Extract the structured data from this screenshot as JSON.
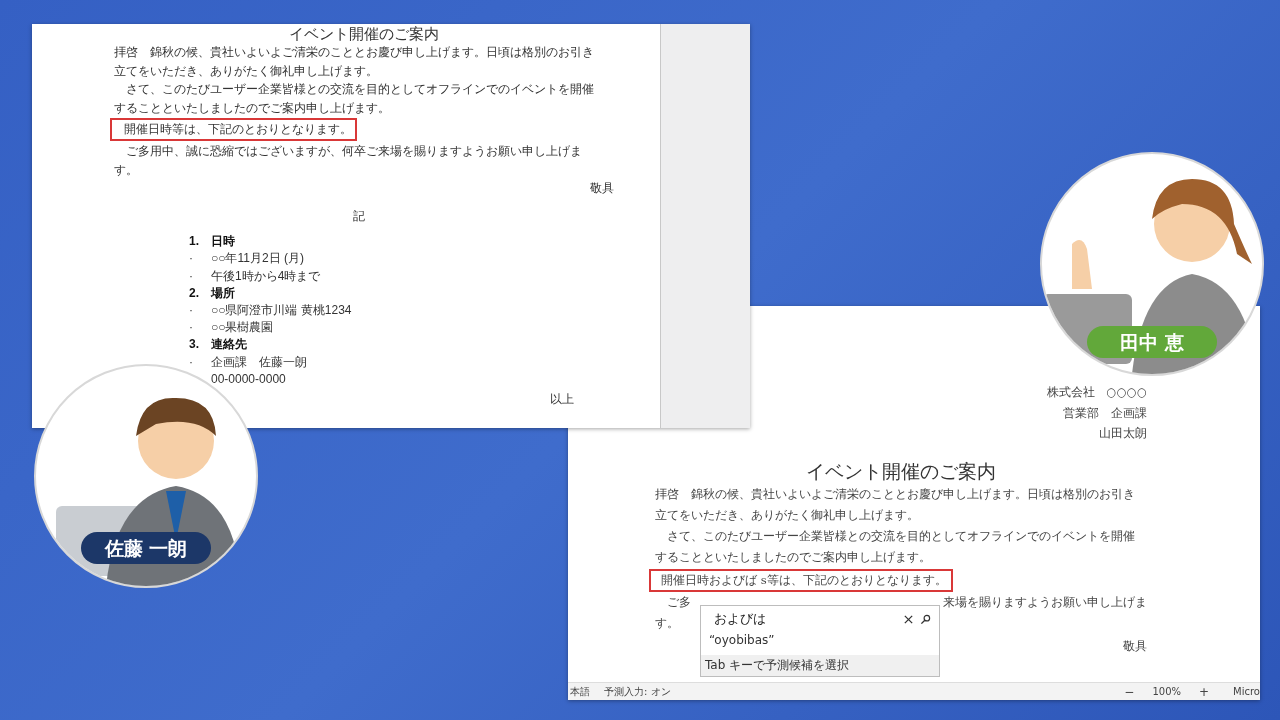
{
  "shared_document": {
    "title": "イベント開催のご案内",
    "lines": [
      {
        "text": "拝啓　錦秋の候、貴社いよいよご清栄のこととお慶び申し上げます。日頃は格別のお引き",
        "highlighted": false
      },
      {
        "text": "立てをいただき、ありがたく御礼申し上げます。",
        "highlighted": false
      },
      {
        "text": "　さて、このたびユーザー企業皆様との交流を目的としてオフラインでのイベントを開催",
        "highlighted": false
      },
      {
        "text": "することといたしましたのでご案内申し上げます。",
        "highlighted": false
      },
      {
        "text": "開催日時等は、下記のとおりとなります。",
        "highlighted": true
      },
      {
        "text": "　ご多用中、誠に恐縮ではございますが、何卒ご来場を賜りますようお願い申し上げま",
        "highlighted": false
      },
      {
        "text": "す。",
        "highlighted": false
      }
    ],
    "closing": "敬具",
    "note_heading": "記",
    "sections": [
      {
        "number": "1.",
        "heading": "日時",
        "items": [
          {
            "bullet": "·",
            "text": "○○年11月2日 (月)"
          },
          {
            "bullet": "·",
            "text": "午後1時から4時まで"
          }
        ]
      },
      {
        "number": "2.",
        "heading": "場所",
        "items": [
          {
            "bullet": "·",
            "text": "○○県阿澄市川端 黄桃1234"
          },
          {
            "bullet": "·",
            "text": "○○果樹農園"
          }
        ]
      },
      {
        "number": "3.",
        "heading": "連絡先",
        "items": [
          {
            "bullet": "·",
            "text": "企画課　佐藤一朗"
          },
          {
            "text": "00-0000-0000"
          }
        ]
      }
    ],
    "end": "以上"
  },
  "editor_document": {
    "sender": [
      "株式会社　○○○○",
      "営業部　企画課",
      "山田太朗"
    ],
    "title": "イベント開催のご案内",
    "lines": [
      {
        "text": "拝啓　錦秋の候、貴社いよいよご清栄のこととお慶び申し上げます。日頃は格別のお引き",
        "highlighted": false
      },
      {
        "text": "立てをいただき、ありがたく御礼申し上げます。",
        "highlighted": false
      },
      {
        "text": "　さて、このたびユーザー企業皆様との交流を目的としてオフラインでのイベントを開催",
        "highlighted": false
      },
      {
        "text": "することといたしましたのでご案内申し上げます。",
        "highlighted": false
      },
      {
        "text": "開催日時およびば s等は、下記のとおりとなります。",
        "highlighted": true
      },
      {
        "text": "　ご多",
        "rest": "来場を賜りますようお願い申し上げま",
        "highlighted": false
      },
      {
        "text": "す。",
        "highlighted": false
      }
    ],
    "closing": "敬具",
    "suggestion": {
      "input": "およびは",
      "candidate": "“oyobibas”",
      "hint": "Tab キーで予測候補を選択"
    },
    "status_bar": {
      "language": "本語",
      "prediction": "予測入力: オン",
      "zoom_out": "−",
      "zoom": "100%",
      "zoom_in": "+",
      "app": "Micro"
    }
  },
  "participants": [
    {
      "name": "佐藤 一朗",
      "kind": "man"
    },
    {
      "name": "田中 恵",
      "kind": "woman"
    }
  ]
}
